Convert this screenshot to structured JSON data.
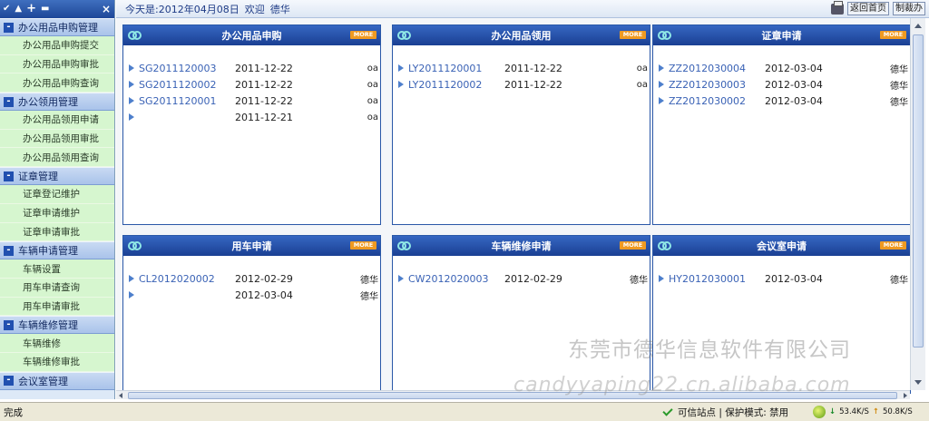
{
  "sidebar": {
    "toolbar": {
      "icons": [
        "check-icon",
        "up-icon",
        "plus-icon",
        "tool-icon"
      ],
      "close": "×"
    },
    "groups": [
      {
        "title": "办公用品申购管理",
        "items": [
          "办公用品申购提交",
          "办公用品申购审批",
          "办公用品申购查询"
        ]
      },
      {
        "title": "办公领用管理",
        "items": [
          "办公用品领用申请",
          "办公用品领用审批",
          "办公用品领用查询"
        ]
      },
      {
        "title": "证章管理",
        "items": [
          "证章登记维护",
          "证章申请维护",
          "证章申请审批"
        ]
      },
      {
        "title": "车辆申请管理",
        "items": [
          "车辆设置",
          "用车申请查询",
          "用车申请审批"
        ]
      },
      {
        "title": "车辆维修管理",
        "items": [
          "车辆维修",
          "车辆维修审批"
        ]
      },
      {
        "title": "会议室管理",
        "items": []
      }
    ]
  },
  "topbar": {
    "today_label": "今天是:2012年04月08日",
    "welcome": "欢迎",
    "user": "德华",
    "buttons": [
      "返回首页",
      "制裁办"
    ]
  },
  "panels": [
    {
      "title": "办公用品申购",
      "more": "MORE",
      "rows": [
        {
          "code": "SG2011120003",
          "date": "2011-12-22",
          "who": "oa"
        },
        {
          "code": "SG2011120002",
          "date": "2011-12-22",
          "who": "oa"
        },
        {
          "code": "SG2011120001",
          "date": "2011-12-22",
          "who": "oa"
        },
        {
          "code": "",
          "date": "2011-12-21",
          "who": "oa"
        }
      ]
    },
    {
      "title": "办公用品领用",
      "more": "MORE",
      "rows": [
        {
          "code": "LY2011120001",
          "date": "2011-12-22",
          "who": "oa"
        },
        {
          "code": "LY2011120002",
          "date": "2011-12-22",
          "who": "oa"
        }
      ]
    },
    {
      "title": "证章申请",
      "more": "MORE",
      "rows": [
        {
          "code": "ZZ2012030004",
          "date": "2012-03-04",
          "who": "德华"
        },
        {
          "code": "ZZ2012030003",
          "date": "2012-03-04",
          "who": "德华"
        },
        {
          "code": "ZZ2012030002",
          "date": "2012-03-04",
          "who": "德华"
        }
      ]
    },
    {
      "title": "用车申请",
      "more": "MORE",
      "rows": [
        {
          "code": "CL2012020002",
          "date": "2012-02-29",
          "who": "德华"
        },
        {
          "code": "",
          "date": "2012-03-04",
          "who": "德华"
        }
      ]
    },
    {
      "title": "车辆维修申请",
      "more": "MORE",
      "rows": [
        {
          "code": "CW2012020003",
          "date": "2012-02-29",
          "who": "德华"
        }
      ]
    },
    {
      "title": "会议室申请",
      "more": "MORE",
      "rows": [
        {
          "code": "HY2012030001",
          "date": "2012-03-04",
          "who": "德华"
        }
      ]
    }
  ],
  "watermark": {
    "line1": "东莞市德华信息软件有限公司",
    "line2": "candyyaping22.cn.alibaba.com"
  },
  "statusbar": {
    "status": "完成",
    "zone": "可信站点 | 保护模式: 禁用",
    "down": "53.4K/S",
    "up": "50.8K/S"
  }
}
